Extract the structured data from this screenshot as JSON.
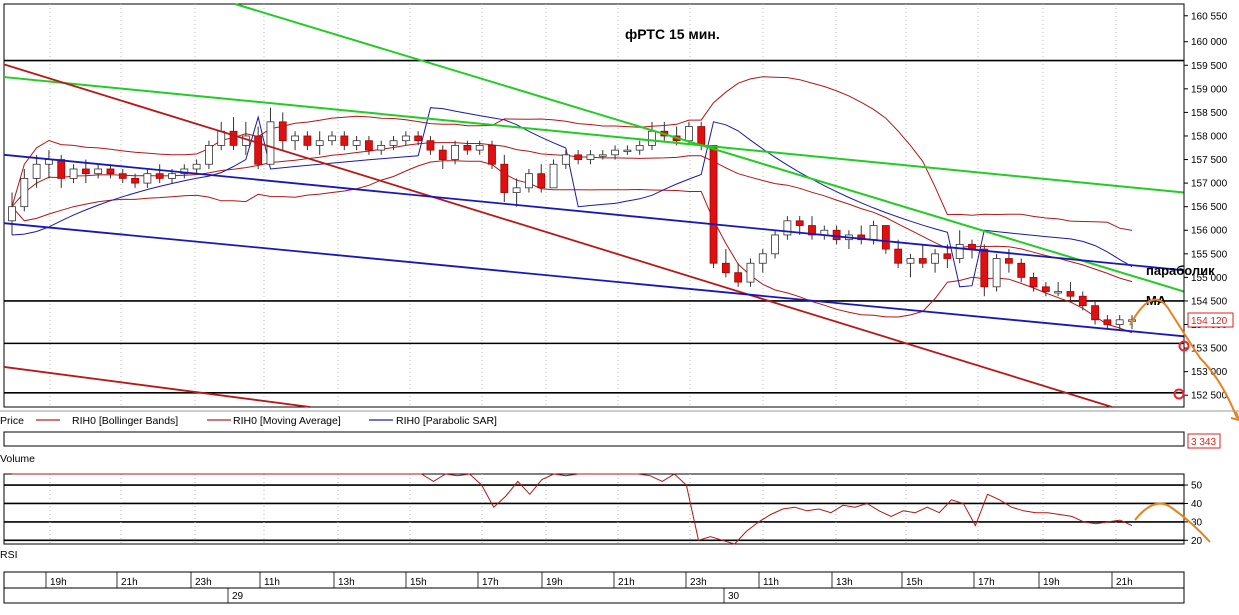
{
  "chart_data": [
    {
      "type": "candlestick",
      "title": "фРТС   15 мин.",
      "panel_label": "Price",
      "y_ticks": [
        "160 550",
        "160 000",
        "159 500",
        "159 000",
        "158 500",
        "158 000",
        "157 500",
        "157 000",
        "156 500",
        "156 000",
        "155 500",
        "155 000",
        "154 500",
        "154 000",
        "153 500",
        "153 000",
        "152 500"
      ],
      "ylim": [
        152250,
        160800
      ],
      "last_price_label": "154 120",
      "legend": [
        "RIH0 [Bollinger Bands]",
        "RIH0 [Moving Average]",
        "RIH0 [Parabolic SAR]"
      ],
      "annotations": [
        "параболик",
        "MA"
      ],
      "horizontal_levels": [
        159600,
        154500,
        153600,
        152550
      ],
      "candles": [
        {
          "o": 156200,
          "h": 156800,
          "l": 155900,
          "c": 156500
        },
        {
          "o": 156500,
          "h": 157300,
          "l": 156400,
          "c": 157100
        },
        {
          "o": 157100,
          "h": 157600,
          "l": 156900,
          "c": 157400
        },
        {
          "o": 157400,
          "h": 157700,
          "l": 157100,
          "c": 157500
        },
        {
          "o": 157500,
          "h": 157600,
          "l": 156900,
          "c": 157100
        },
        {
          "o": 157100,
          "h": 157400,
          "l": 157000,
          "c": 157300
        },
        {
          "o": 157300,
          "h": 157500,
          "l": 157000,
          "c": 157200
        },
        {
          "o": 157200,
          "h": 157400,
          "l": 157100,
          "c": 157300
        },
        {
          "o": 157300,
          "h": 157400,
          "l": 157100,
          "c": 157200
        },
        {
          "o": 157200,
          "h": 157300,
          "l": 157000,
          "c": 157100
        },
        {
          "o": 157100,
          "h": 157200,
          "l": 156900,
          "c": 157000
        },
        {
          "o": 157000,
          "h": 157300,
          "l": 156900,
          "c": 157200
        },
        {
          "o": 157200,
          "h": 157400,
          "l": 157000,
          "c": 157100
        },
        {
          "o": 157100,
          "h": 157300,
          "l": 157000,
          "c": 157200
        },
        {
          "o": 157200,
          "h": 157400,
          "l": 157100,
          "c": 157300
        },
        {
          "o": 157300,
          "h": 157500,
          "l": 157200,
          "c": 157400
        },
        {
          "o": 157400,
          "h": 157900,
          "l": 157300,
          "c": 157800
        },
        {
          "o": 157800,
          "h": 158300,
          "l": 157700,
          "c": 158100
        },
        {
          "o": 158100,
          "h": 158400,
          "l": 157700,
          "c": 157800
        },
        {
          "o": 157800,
          "h": 158300,
          "l": 157600,
          "c": 158000
        },
        {
          "o": 158000,
          "h": 158200,
          "l": 157300,
          "c": 157400
        },
        {
          "o": 157400,
          "h": 158600,
          "l": 157400,
          "c": 158300
        },
        {
          "o": 158300,
          "h": 158500,
          "l": 157700,
          "c": 157900
        },
        {
          "o": 157900,
          "h": 158100,
          "l": 157700,
          "c": 158000
        },
        {
          "o": 158000,
          "h": 158100,
          "l": 157700,
          "c": 157800
        },
        {
          "o": 157800,
          "h": 158100,
          "l": 157600,
          "c": 157900
        },
        {
          "o": 157900,
          "h": 158100,
          "l": 157800,
          "c": 158000
        },
        {
          "o": 158000,
          "h": 158100,
          "l": 157700,
          "c": 157800
        },
        {
          "o": 157800,
          "h": 158000,
          "l": 157700,
          "c": 157900
        },
        {
          "o": 157900,
          "h": 158000,
          "l": 157600,
          "c": 157700
        },
        {
          "o": 157700,
          "h": 157900,
          "l": 157600,
          "c": 157800
        },
        {
          "o": 157800,
          "h": 158000,
          "l": 157700,
          "c": 157900
        },
        {
          "o": 157900,
          "h": 158100,
          "l": 157800,
          "c": 158000
        },
        {
          "o": 158000,
          "h": 158100,
          "l": 157800,
          "c": 157900
        },
        {
          "o": 157900,
          "h": 158000,
          "l": 157600,
          "c": 157700
        },
        {
          "o": 157700,
          "h": 157800,
          "l": 157300,
          "c": 157500
        },
        {
          "o": 157500,
          "h": 157900,
          "l": 157400,
          "c": 157800
        },
        {
          "o": 157800,
          "h": 157900,
          "l": 157600,
          "c": 157700
        },
        {
          "o": 157700,
          "h": 157900,
          "l": 157600,
          "c": 157800
        },
        {
          "o": 157800,
          "h": 157900,
          "l": 157300,
          "c": 157400
        },
        {
          "o": 157400,
          "h": 157600,
          "l": 156600,
          "c": 156800
        },
        {
          "o": 156800,
          "h": 157100,
          "l": 156500,
          "c": 156900
        },
        {
          "o": 156900,
          "h": 157300,
          "l": 156800,
          "c": 157200
        },
        {
          "o": 157200,
          "h": 157400,
          "l": 156800,
          "c": 156900
        },
        {
          "o": 156900,
          "h": 157500,
          "l": 156900,
          "c": 157400
        },
        {
          "o": 157400,
          "h": 157700,
          "l": 157300,
          "c": 157600
        },
        {
          "o": 157600,
          "h": 157700,
          "l": 157400,
          "c": 157500
        },
        {
          "o": 157500,
          "h": 157700,
          "l": 157400,
          "c": 157600
        },
        {
          "o": 157600,
          "h": 157700,
          "l": 157500,
          "c": 157600
        },
        {
          "o": 157600,
          "h": 157800,
          "l": 157500,
          "c": 157700
        },
        {
          "o": 157700,
          "h": 157800,
          "l": 157600,
          "c": 157700
        },
        {
          "o": 157700,
          "h": 157900,
          "l": 157600,
          "c": 157800
        },
        {
          "o": 157800,
          "h": 158300,
          "l": 157700,
          "c": 158100
        },
        {
          "o": 158100,
          "h": 158300,
          "l": 157900,
          "c": 158000
        },
        {
          "o": 158000,
          "h": 158200,
          "l": 157800,
          "c": 157900
        },
        {
          "o": 157900,
          "h": 158300,
          "l": 157800,
          "c": 158200
        },
        {
          "o": 158200,
          "h": 158300,
          "l": 157700,
          "c": 157800
        },
        {
          "o": 157800,
          "h": 157800,
          "l": 155200,
          "c": 155300
        },
        {
          "o": 155300,
          "h": 155600,
          "l": 155000,
          "c": 155100
        },
        {
          "o": 155100,
          "h": 155300,
          "l": 154800,
          "c": 154900
        },
        {
          "o": 154900,
          "h": 155400,
          "l": 154800,
          "c": 155300
        },
        {
          "o": 155300,
          "h": 155600,
          "l": 155100,
          "c": 155500
        },
        {
          "o": 155500,
          "h": 156000,
          "l": 155400,
          "c": 155900
        },
        {
          "o": 155900,
          "h": 156300,
          "l": 155800,
          "c": 156200
        },
        {
          "o": 156200,
          "h": 156300,
          "l": 155900,
          "c": 156100
        },
        {
          "o": 156100,
          "h": 156300,
          "l": 155800,
          "c": 155900
        },
        {
          "o": 155900,
          "h": 156100,
          "l": 155800,
          "c": 156000
        },
        {
          "o": 156000,
          "h": 156100,
          "l": 155700,
          "c": 155800
        },
        {
          "o": 155800,
          "h": 156000,
          "l": 155600,
          "c": 155900
        },
        {
          "o": 155900,
          "h": 156100,
          "l": 155700,
          "c": 155800
        },
        {
          "o": 155800,
          "h": 156200,
          "l": 155700,
          "c": 156100
        },
        {
          "o": 156100,
          "h": 156100,
          "l": 155500,
          "c": 155600
        },
        {
          "o": 155600,
          "h": 155800,
          "l": 155200,
          "c": 155300
        },
        {
          "o": 155300,
          "h": 155500,
          "l": 155000,
          "c": 155400
        },
        {
          "o": 155400,
          "h": 155700,
          "l": 155200,
          "c": 155300
        },
        {
          "o": 155300,
          "h": 155600,
          "l": 155100,
          "c": 155500
        },
        {
          "o": 155500,
          "h": 155700,
          "l": 155200,
          "c": 155400
        },
        {
          "o": 155400,
          "h": 156000,
          "l": 155300,
          "c": 155700
        },
        {
          "o": 155700,
          "h": 155800,
          "l": 155400,
          "c": 155600
        },
        {
          "o": 155600,
          "h": 155700,
          "l": 154600,
          "c": 154800
        },
        {
          "o": 154800,
          "h": 155500,
          "l": 154700,
          "c": 155400
        },
        {
          "o": 155400,
          "h": 155600,
          "l": 155100,
          "c": 155300
        },
        {
          "o": 155300,
          "h": 155400,
          "l": 154900,
          "c": 155000
        },
        {
          "o": 155000,
          "h": 155100,
          "l": 154700,
          "c": 154800
        },
        {
          "o": 154800,
          "h": 154900,
          "l": 154600,
          "c": 154700
        },
        {
          "o": 154700,
          "h": 154900,
          "l": 154600,
          "c": 154700
        },
        {
          "o": 154700,
          "h": 154900,
          "l": 154500,
          "c": 154600
        },
        {
          "o": 154600,
          "h": 154700,
          "l": 154300,
          "c": 154400
        },
        {
          "o": 154400,
          "h": 154500,
          "l": 154000,
          "c": 154100
        },
        {
          "o": 154100,
          "h": 154200,
          "l": 153900,
          "c": 154000
        },
        {
          "o": 154000,
          "h": 154200,
          "l": 153900,
          "c": 154100
        },
        {
          "o": 154100,
          "h": 154200,
          "l": 153900,
          "c": 154100
        }
      ]
    },
    {
      "type": "bar",
      "panel_label": "Volume",
      "last_value_label": "3 343"
    },
    {
      "type": "line",
      "panel_label": "RSI",
      "y_ticks": [
        "50",
        "40",
        "30",
        "20"
      ],
      "ylim": [
        18,
        56
      ],
      "levels": [
        50,
        40,
        30,
        20
      ],
      "values": [
        60,
        58,
        62,
        59,
        60,
        61,
        60,
        58,
        59,
        57,
        60,
        61,
        60,
        59,
        58,
        61,
        65,
        68,
        62,
        64,
        58,
        66,
        60,
        59,
        57,
        58,
        60,
        57,
        58,
        56,
        57,
        59,
        61,
        59,
        56,
        52,
        58,
        55,
        57,
        50,
        38,
        44,
        52,
        45,
        53,
        58,
        55,
        56,
        56,
        58,
        56,
        57,
        63,
        55,
        52,
        60,
        50,
        20,
        22,
        20,
        18,
        25,
        30,
        34,
        37,
        38,
        36,
        37,
        35,
        39,
        38,
        40,
        36,
        33,
        36,
        35,
        38,
        35,
        42,
        40,
        28,
        45,
        42,
        38,
        36,
        35,
        35,
        34,
        33,
        30,
        29,
        30,
        31,
        28
      ]
    }
  ],
  "time_axis": {
    "hours": [
      "19h",
      "21h",
      "23h",
      "11h",
      "13h",
      "15h",
      "17h",
      "19h",
      "21h",
      "23h",
      "11h",
      "13h",
      "15h",
      "17h",
      "19h",
      "21h"
    ],
    "dates": [
      "29",
      "30"
    ]
  }
}
